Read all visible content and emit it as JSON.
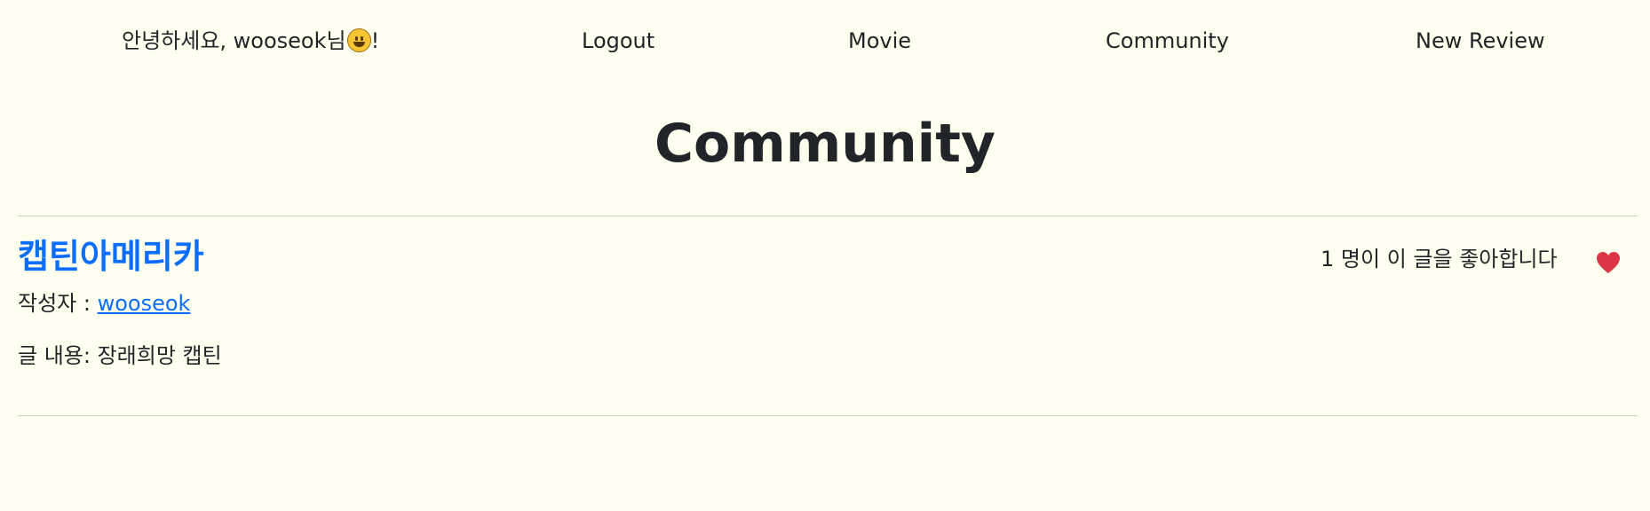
{
  "colors": {
    "background": "#fffff0",
    "link": "#0d6efd",
    "heart": "#dc3545",
    "text": "#212529"
  },
  "nav": {
    "greeting_prefix": "안녕하세요, wooseok님",
    "greeting_icon": "grinning-face-icon",
    "greeting_suffix": "!",
    "items": [
      {
        "label": "Logout"
      },
      {
        "label": "Movie"
      },
      {
        "label": "Community"
      },
      {
        "label": "New Review"
      }
    ]
  },
  "page": {
    "title": "Community"
  },
  "review": {
    "title": "캡틴아메리카",
    "author_label": "작성자 : ",
    "author": "wooseok",
    "content_label": "글 내용: ",
    "content": "장래희망 캡틴",
    "like_count": "1",
    "like_text_suffix": " 명이 이 글을 좋아합니다",
    "like_icon": "heart-icon",
    "liked": true
  }
}
